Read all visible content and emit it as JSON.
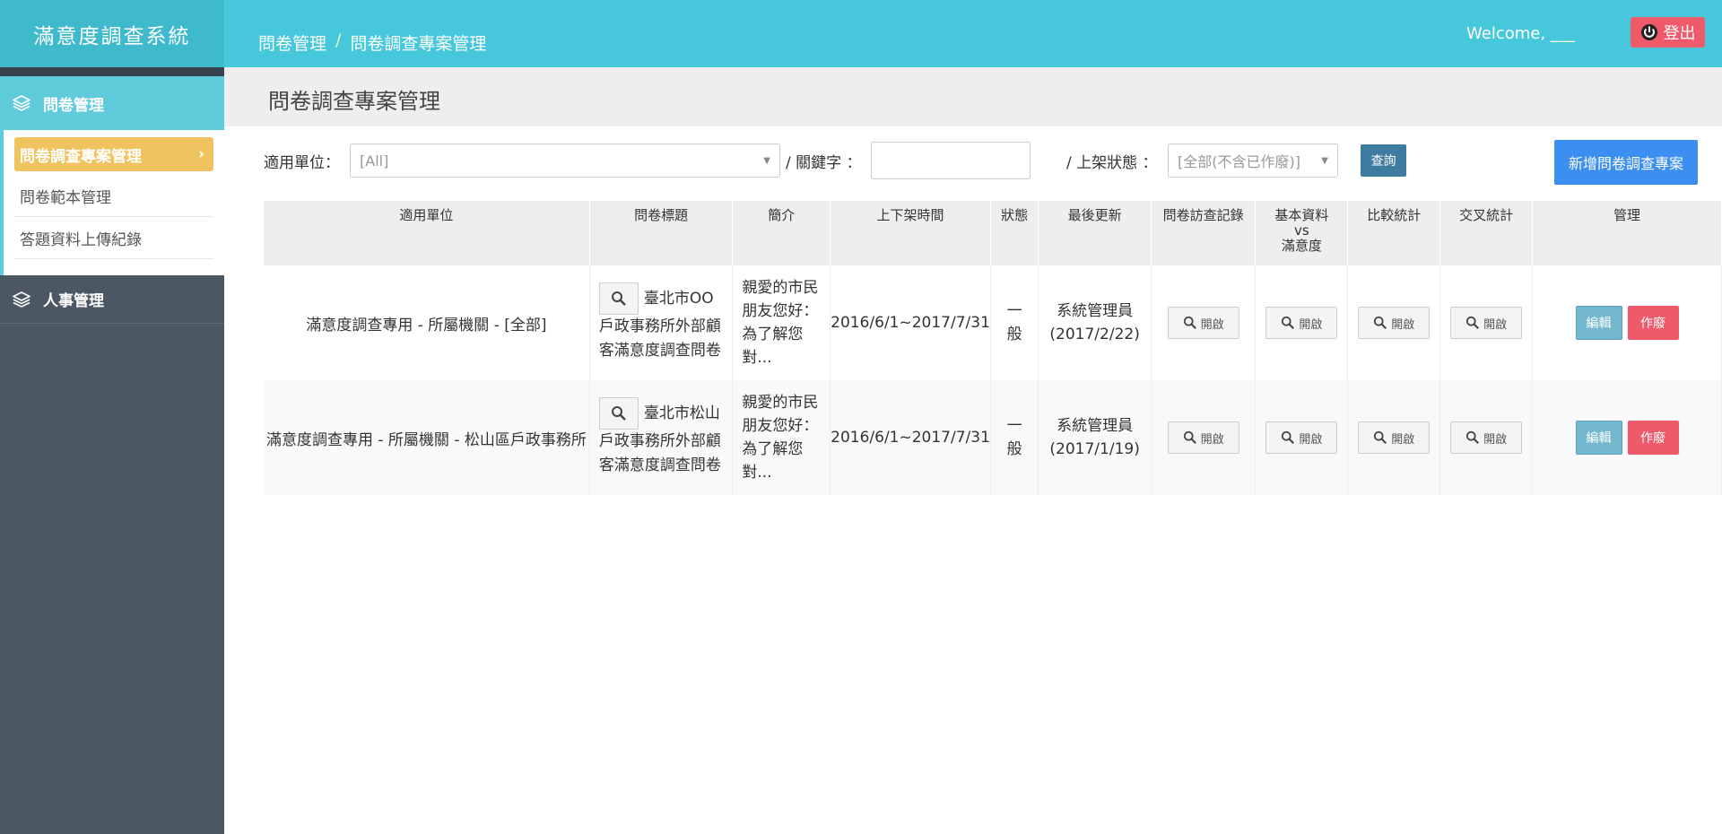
{
  "app": {
    "brand": "滿意度調查系統"
  },
  "sidebar": {
    "groups": [
      {
        "label": "問卷管理",
        "items": [
          "問卷調查專案管理",
          "問卷範本管理",
          "答題資料上傳紀錄"
        ]
      },
      {
        "label": "人事管理"
      }
    ],
    "active_chevron": "›"
  },
  "header": {
    "breadcrumb": [
      "問卷管理",
      "/",
      "問卷調查專案管理"
    ],
    "welcome": "Welcome, ___",
    "logout": "登出"
  },
  "page": {
    "title": "問卷調查專案管理"
  },
  "filters": {
    "unit_label": "適用單位：",
    "unit_value": "[All]",
    "keyword_label": "/ 關鍵字 ：",
    "keyword_value": "",
    "status_label": "/ 上架狀態 ：",
    "status_value": "[全部(不含已作廢)]",
    "query_button": "查詢",
    "add_button": "新增問卷調查專案"
  },
  "table": {
    "headers": [
      "適用單位",
      "問卷標題",
      "簡介",
      "上下架時間",
      "狀態",
      "最後更新",
      "問卷訪查記錄",
      "基本資料\nvs\n滿意度",
      "比較統計",
      "交叉統計",
      "管理"
    ],
    "open_label": "開啟",
    "edit_label": "編輯",
    "void_label": "作廢",
    "rows": [
      {
        "unit": "滿意度調查專用 - 所屬機關 - [全部]",
        "title": "臺北市OO戶政事務所外部顧客滿意度調查問卷",
        "intro": "親愛的市民朋友您好：為了解您對...",
        "period": "2016/6/1~2017/7/31",
        "status": "一般",
        "updated": "系統管理員(2017/2/22)"
      },
      {
        "unit": "滿意度調查專用 - 所屬機關 - 松山區戶政事務所",
        "title": "臺北市松山戶政事務所外部顧客滿意度調查問卷",
        "intro": "親愛的市民朋友您好：為了解您對...",
        "period": "2016/6/1~2017/7/31",
        "status": "一般",
        "updated": "系統管理員(2017/1/19)"
      }
    ]
  },
  "colors": {
    "header": "#47c7dc",
    "sidebar": "#4b5863",
    "active_item": "#efc35e",
    "danger": "#ef5a6b",
    "primary": "#3c8ff0"
  }
}
